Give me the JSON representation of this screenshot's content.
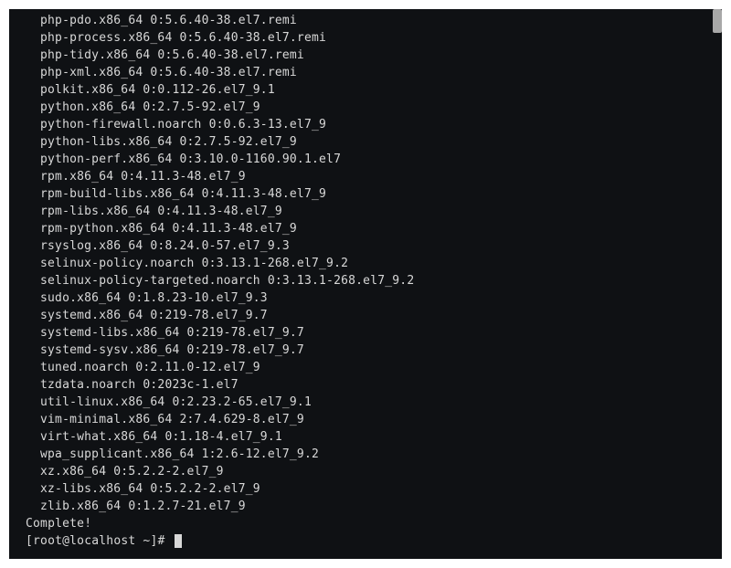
{
  "terminal": {
    "package_lines": [
      "php-pdo.x86_64 0:5.6.40-38.el7.remi",
      "php-process.x86_64 0:5.6.40-38.el7.remi",
      "php-tidy.x86_64 0:5.6.40-38.el7.remi",
      "php-xml.x86_64 0:5.6.40-38.el7.remi",
      "polkit.x86_64 0:0.112-26.el7_9.1",
      "python.x86_64 0:2.7.5-92.el7_9",
      "python-firewall.noarch 0:0.6.3-13.el7_9",
      "python-libs.x86_64 0:2.7.5-92.el7_9",
      "python-perf.x86_64 0:3.10.0-1160.90.1.el7",
      "rpm.x86_64 0:4.11.3-48.el7_9",
      "rpm-build-libs.x86_64 0:4.11.3-48.el7_9",
      "rpm-libs.x86_64 0:4.11.3-48.el7_9",
      "rpm-python.x86_64 0:4.11.3-48.el7_9",
      "rsyslog.x86_64 0:8.24.0-57.el7_9.3",
      "selinux-policy.noarch 0:3.13.1-268.el7_9.2",
      "selinux-policy-targeted.noarch 0:3.13.1-268.el7_9.2",
      "sudo.x86_64 0:1.8.23-10.el7_9.3",
      "systemd.x86_64 0:219-78.el7_9.7",
      "systemd-libs.x86_64 0:219-78.el7_9.7",
      "systemd-sysv.x86_64 0:219-78.el7_9.7",
      "tuned.noarch 0:2.11.0-12.el7_9",
      "tzdata.noarch 0:2023c-1.el7",
      "util-linux.x86_64 0:2.23.2-65.el7_9.1",
      "vim-minimal.x86_64 2:7.4.629-8.el7_9",
      "virt-what.x86_64 0:1.18-4.el7_9.1",
      "wpa_supplicant.x86_64 1:2.6-12.el7_9.2",
      "xz.x86_64 0:5.2.2-2.el7_9",
      "xz-libs.x86_64 0:5.2.2-2.el7_9",
      "zlib.x86_64 0:1.2.7-21.el7_9"
    ],
    "blank_line": "",
    "complete_label": "Complete!",
    "prompt": "[root@localhost ~]# "
  }
}
